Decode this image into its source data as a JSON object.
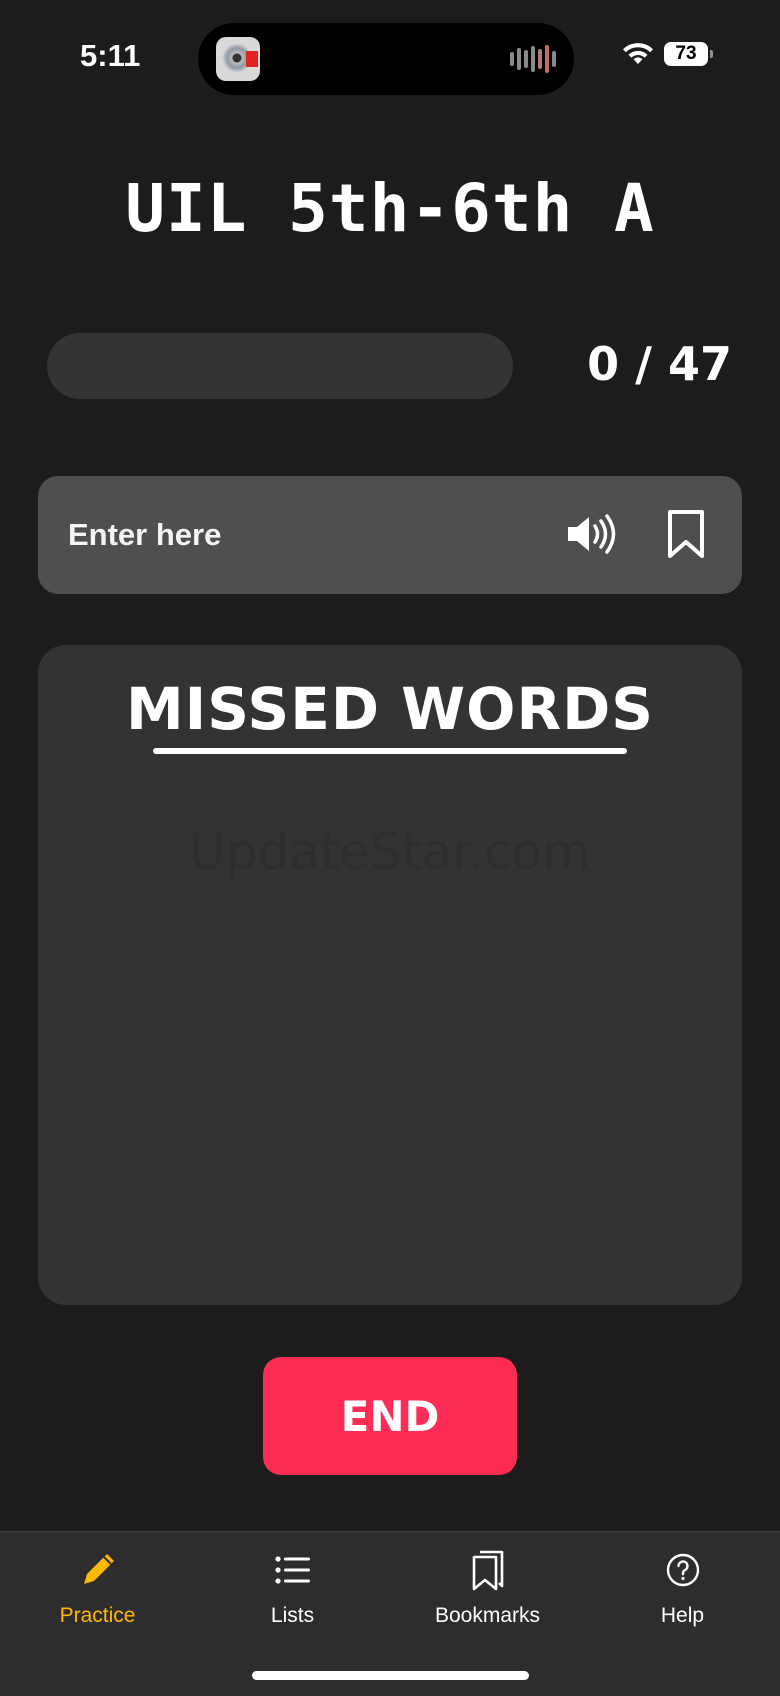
{
  "status_bar": {
    "time": "5:11",
    "battery": "73"
  },
  "header": {
    "title": "UIL 5th-6th A"
  },
  "progress": {
    "current": 0,
    "total": 47,
    "label": "0 / 47",
    "fraction": 0
  },
  "answer": {
    "placeholder": "Enter here",
    "value": ""
  },
  "icons": {
    "speaker": "speaker-icon",
    "bookmark": "bookmark-icon"
  },
  "missed_words": {
    "title": "MISSED WORDS",
    "items": []
  },
  "watermark": "UpdateStar.com",
  "end_button": {
    "label": "END",
    "color": "#ff2d55"
  },
  "tabs": [
    {
      "label": "Practice",
      "icon": "pencil-icon",
      "active": true
    },
    {
      "label": "Lists",
      "icon": "list-icon",
      "active": false
    },
    {
      "label": "Bookmarks",
      "icon": "bookmarks-icon",
      "active": false
    },
    {
      "label": "Help",
      "icon": "help-icon",
      "active": false
    }
  ],
  "colors": {
    "background": "#1c1c1d",
    "accent": "#ffb800",
    "card": "#333334",
    "input_card": "#4f4f50"
  }
}
